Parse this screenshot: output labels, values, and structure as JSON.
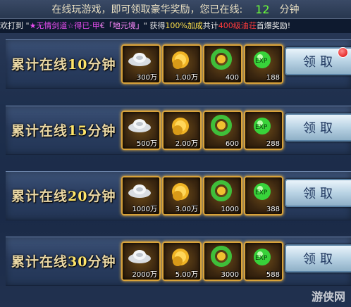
{
  "header": {
    "text_prefix": "在线玩游戏，即可领取豪华奖励，您已在线:",
    "online_minutes": "12",
    "unit": "分钟"
  },
  "ticker": {
    "part1": "欢打到 \"",
    "player": "★无情剑道☆得已·甲",
    "item": "€「地元境」",
    "part2": "\" 获得",
    "pct": "100%加成",
    "part3": "共计",
    "amount": "400级油荘",
    "part4": "首爆奖励!"
  },
  "rows": [
    {
      "label_a": "累计在线",
      "minutes": "10",
      "label_b": "分钟",
      "silver": "300万",
      "gold": "1.00万",
      "herb": "400",
      "exp": "188",
      "claim": "领取",
      "has_alert": true
    },
    {
      "label_a": "累计在线",
      "minutes": "15",
      "label_b": "分钟",
      "silver": "500万",
      "gold": "2.00万",
      "herb": "600",
      "exp": "288",
      "claim": "领取",
      "has_alert": false
    },
    {
      "label_a": "累计在线",
      "minutes": "20",
      "label_b": "分钟",
      "silver": "1000万",
      "gold": "3.00万",
      "herb": "1000",
      "exp": "388",
      "claim": "领取",
      "has_alert": false
    },
    {
      "label_a": "累计在线",
      "minutes": "30",
      "label_b": "分钟",
      "silver": "2000万",
      "gold": "5.00万",
      "herb": "3000",
      "exp": "588",
      "claim": "领取",
      "has_alert": false
    }
  ],
  "icons": {
    "silver": "silver-ingot-icon",
    "gold": "gold-coin-icon",
    "herb": "herb-wreath-icon",
    "exp": "exp-orb-icon"
  },
  "watermark": "游侠网"
}
